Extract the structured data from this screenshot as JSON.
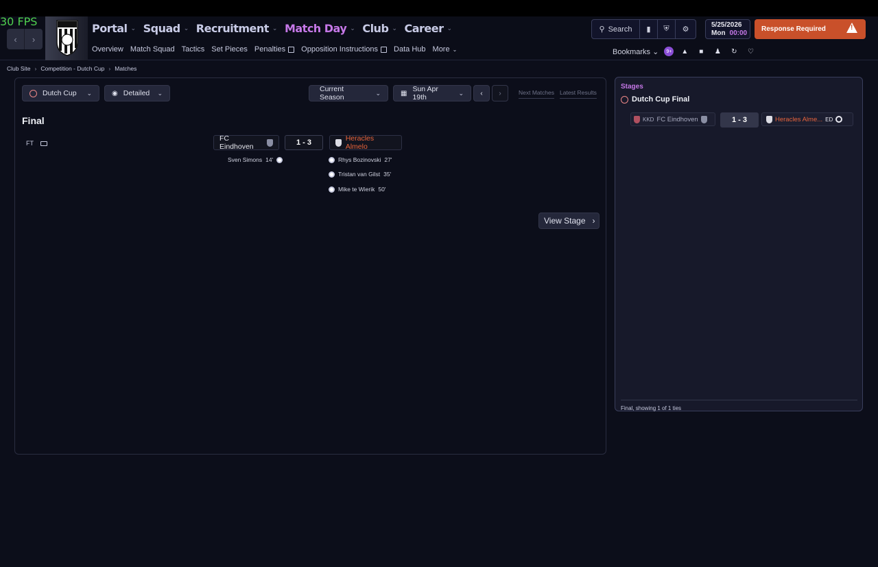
{
  "fps": "30 FPS",
  "nav": {
    "main": [
      {
        "label": "Portal",
        "active": false
      },
      {
        "label": "Squad",
        "active": false
      },
      {
        "label": "Recruitment",
        "active": false
      },
      {
        "label": "Match Day",
        "active": true
      },
      {
        "label": "Club",
        "active": false
      },
      {
        "label": "Career",
        "active": false
      }
    ],
    "sub": [
      "Overview",
      "Match Squad",
      "Tactics",
      "Set Pieces",
      "Penalties",
      "Opposition Instructions",
      "Data Hub",
      "More"
    ]
  },
  "toolbar": {
    "search_label": "Search",
    "date": "5/25/2026",
    "day": "Mon",
    "time": "00:00",
    "response_label": "Response Required",
    "bookmarks_label": "Bookmarks",
    "notification_count": "9+"
  },
  "breadcrumb": [
    "Club Site",
    "Competition - Dutch Cup",
    "Matches"
  ],
  "filters": {
    "competition": "Dutch Cup",
    "view": "Detailed",
    "season": "Current Season",
    "date": "Sun Apr 19th",
    "next_matches": "Next Matches",
    "latest_results": "Latest Results"
  },
  "match": {
    "section_title": "Final",
    "status": "FT",
    "home_team": "FC Eindhoven",
    "away_team": "Heracles Almelo",
    "score": "1 - 3",
    "home_scorers": [
      {
        "name": "Sven Simons",
        "minute": "14'"
      }
    ],
    "away_scorers": [
      {
        "name": "Rhys Bozinovski",
        "minute": "27'"
      },
      {
        "name": "Tristan van Gilst",
        "minute": "35'"
      },
      {
        "name": "Mike te Wierik",
        "minute": "50'"
      }
    ],
    "view_stage_label": "View Stage"
  },
  "stages": {
    "label": "Stages",
    "title": "Dutch Cup Final",
    "tie": {
      "home_abbr": "KKD",
      "home_team": "FC Eindhoven",
      "score": "1 - 3",
      "away_team": "Heracles Alme...",
      "away_abbr": "ED"
    },
    "footer": "Final, showing 1 of 1 ties"
  },
  "colors": {
    "accent": "#c678e8",
    "away_team": "#e8643c",
    "response": "#c9502a"
  }
}
